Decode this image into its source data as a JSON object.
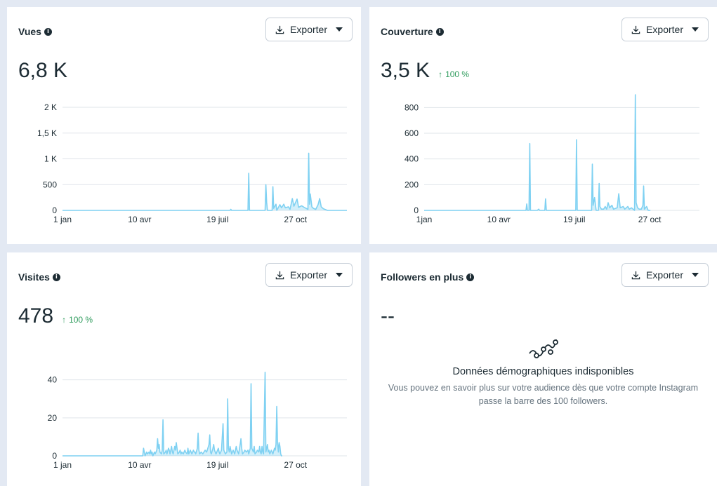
{
  "icons": {
    "info": "info-icon",
    "download": "download-icon",
    "caret": "caret-down-icon",
    "delta": "arrow-up-icon",
    "empty_chart": "chart-line-icon"
  },
  "colors": {
    "series": "#7fd1f2",
    "delta": "#2e9b5c",
    "background": "#e3e9f3"
  },
  "cards": {
    "vues": {
      "title": "Vues",
      "info_glyph": "i",
      "export_label": "Exporter",
      "value": "6,8 K",
      "chart_data": {
        "type": "area",
        "ylim": [
          0,
          2000
        ],
        "y_ticks": [
          {
            "v": 0,
            "label": "0"
          },
          {
            "v": 500,
            "label": "500"
          },
          {
            "v": 1000,
            "label": "1 K"
          },
          {
            "v": 1500,
            "label": "1,5 K"
          },
          {
            "v": 2000,
            "label": "2 K"
          }
        ],
        "x_ticks": [
          "1 jan",
          "10 avr",
          "19 juil",
          "27 oct"
        ],
        "x_tick_days": [
          0,
          99,
          199,
          299
        ],
        "x_range": [
          0,
          365
        ],
        "points": [
          [
            0,
            0
          ],
          [
            215,
            0
          ],
          [
            216,
            20
          ],
          [
            217,
            0
          ],
          [
            238,
            0
          ],
          [
            239,
            720
          ],
          [
            240,
            0
          ],
          [
            260,
            0
          ],
          [
            261,
            500
          ],
          [
            262,
            160
          ],
          [
            263,
            0
          ],
          [
            269,
            0
          ],
          [
            270,
            460
          ],
          [
            271,
            40
          ],
          [
            274,
            120
          ],
          [
            275,
            0
          ],
          [
            279,
            110
          ],
          [
            281,
            50
          ],
          [
            284,
            120
          ],
          [
            286,
            50
          ],
          [
            290,
            70
          ],
          [
            292,
            20
          ],
          [
            295,
            230
          ],
          [
            297,
            80
          ],
          [
            301,
            220
          ],
          [
            303,
            60
          ],
          [
            307,
            90
          ],
          [
            310,
            60
          ],
          [
            315,
            20
          ],
          [
            316,
            1110
          ],
          [
            317,
            120
          ],
          [
            318,
            320
          ],
          [
            320,
            70
          ],
          [
            322,
            40
          ],
          [
            325,
            20
          ],
          [
            328,
            110
          ],
          [
            330,
            230
          ],
          [
            332,
            70
          ],
          [
            335,
            30
          ],
          [
            340,
            0
          ],
          [
            365,
            0
          ]
        ]
      }
    },
    "couverture": {
      "title": "Couverture",
      "info_glyph": "i",
      "export_label": "Exporter",
      "value": "3,5 K",
      "delta": "100 %",
      "delta_glyph": "↑",
      "chart_data": {
        "type": "area",
        "ylim": [
          0,
          900
        ],
        "y_ticks": [
          {
            "v": 0,
            "label": "0"
          },
          {
            "v": 200,
            "label": "200"
          },
          {
            "v": 400,
            "label": "400"
          },
          {
            "v": 600,
            "label": "600"
          },
          {
            "v": 800,
            "label": "800"
          }
        ],
        "x_ticks": [
          "1jan",
          "10 avr",
          "19 juil",
          "27 oct"
        ],
        "x_tick_days": [
          0,
          99,
          199,
          299
        ],
        "x_range": [
          0,
          365
        ],
        "points": [
          [
            0,
            0
          ],
          [
            135,
            0
          ],
          [
            136,
            50
          ],
          [
            137,
            0
          ],
          [
            139,
            0
          ],
          [
            140,
            520
          ],
          [
            141,
            0
          ],
          [
            150,
            0
          ],
          [
            152,
            10
          ],
          [
            153,
            0
          ],
          [
            160,
            0
          ],
          [
            161,
            90
          ],
          [
            162,
            0
          ],
          [
            180,
            0
          ],
          [
            190,
            0
          ],
          [
            201,
            0
          ],
          [
            202,
            550
          ],
          [
            203,
            0
          ],
          [
            222,
            0
          ],
          [
            223,
            360
          ],
          [
            224,
            40
          ],
          [
            226,
            100
          ],
          [
            228,
            0
          ],
          [
            231,
            0
          ],
          [
            232,
            210
          ],
          [
            233,
            30
          ],
          [
            235,
            10
          ],
          [
            238,
            10
          ],
          [
            240,
            30
          ],
          [
            242,
            10
          ],
          [
            244,
            60
          ],
          [
            246,
            20
          ],
          [
            249,
            40
          ],
          [
            251,
            10
          ],
          [
            256,
            20
          ],
          [
            258,
            130
          ],
          [
            260,
            20
          ],
          [
            264,
            30
          ],
          [
            266,
            10
          ],
          [
            270,
            30
          ],
          [
            272,
            10
          ],
          [
            275,
            20
          ],
          [
            277,
            10
          ],
          [
            279,
            0
          ],
          [
            280,
            900
          ],
          [
            281,
            60
          ],
          [
            283,
            20
          ],
          [
            285,
            10
          ],
          [
            288,
            10
          ],
          [
            290,
            40
          ],
          [
            291,
            190
          ],
          [
            292,
            10
          ],
          [
            295,
            30
          ],
          [
            297,
            0
          ],
          [
            300,
            0
          ]
        ]
      }
    },
    "visites": {
      "title": "Visites",
      "info_glyph": "i",
      "export_label": "Exporter",
      "value": "478",
      "delta": "100 %",
      "delta_glyph": "↑",
      "chart_data": {
        "type": "area",
        "ylim": [
          0,
          48
        ],
        "y_ticks": [
          {
            "v": 0,
            "label": "0"
          },
          {
            "v": 20,
            "label": "20"
          },
          {
            "v": 40,
            "label": "40"
          }
        ],
        "x_ticks": [
          "1 jan",
          "10 avr",
          "19 juil",
          "27 oct"
        ],
        "x_tick_days": [
          0,
          99,
          199,
          299
        ],
        "x_range": [
          0,
          365
        ],
        "points": [
          [
            0,
            0
          ],
          [
            103,
            0
          ],
          [
            104,
            4
          ],
          [
            105,
            2
          ],
          [
            106,
            0
          ],
          [
            108,
            2
          ],
          [
            109,
            1
          ],
          [
            111,
            2
          ],
          [
            112,
            1
          ],
          [
            113,
            3
          ],
          [
            114,
            1
          ],
          [
            115,
            2
          ],
          [
            116,
            0
          ],
          [
            118,
            2
          ],
          [
            119,
            1
          ],
          [
            121,
            3
          ],
          [
            122,
            9
          ],
          [
            123,
            4
          ],
          [
            124,
            6
          ],
          [
            125,
            2
          ],
          [
            127,
            1
          ],
          [
            128,
            3
          ],
          [
            129,
            19
          ],
          [
            130,
            1
          ],
          [
            132,
            2
          ],
          [
            133,
            3
          ],
          [
            134,
            1
          ],
          [
            136,
            4
          ],
          [
            137,
            3
          ],
          [
            138,
            1
          ],
          [
            140,
            5
          ],
          [
            141,
            2
          ],
          [
            142,
            1
          ],
          [
            144,
            5
          ],
          [
            145,
            3
          ],
          [
            146,
            7
          ],
          [
            147,
            4
          ],
          [
            148,
            1
          ],
          [
            150,
            2
          ],
          [
            151,
            3
          ],
          [
            152,
            1
          ],
          [
            153,
            2
          ],
          [
            155,
            1
          ],
          [
            157,
            3
          ],
          [
            158,
            2
          ],
          [
            160,
            1
          ],
          [
            161,
            4
          ],
          [
            162,
            1
          ],
          [
            164,
            3
          ],
          [
            165,
            2
          ],
          [
            166,
            1
          ],
          [
            168,
            3
          ],
          [
            169,
            2
          ],
          [
            170,
            2
          ],
          [
            171,
            1
          ],
          [
            173,
            4
          ],
          [
            174,
            12
          ],
          [
            175,
            3
          ],
          [
            176,
            1
          ],
          [
            178,
            2
          ],
          [
            180,
            1
          ],
          [
            183,
            3
          ],
          [
            185,
            2
          ],
          [
            188,
            6
          ],
          [
            189,
            11
          ],
          [
            190,
            2
          ],
          [
            191,
            1
          ],
          [
            193,
            4
          ],
          [
            194,
            6
          ],
          [
            195,
            3
          ],
          [
            196,
            2
          ],
          [
            197,
            1
          ],
          [
            199,
            3
          ],
          [
            200,
            4
          ],
          [
            201,
            2
          ],
          [
            202,
            1
          ],
          [
            204,
            3
          ],
          [
            206,
            17
          ],
          [
            207,
            3
          ],
          [
            208,
            2
          ],
          [
            209,
            1
          ],
          [
            211,
            2
          ],
          [
            212,
            30
          ],
          [
            213,
            4
          ],
          [
            214,
            2
          ],
          [
            215,
            5
          ],
          [
            216,
            3
          ],
          [
            217,
            1
          ],
          [
            219,
            3
          ],
          [
            220,
            2
          ],
          [
            221,
            1
          ],
          [
            223,
            5
          ],
          [
            224,
            3
          ],
          [
            225,
            2
          ],
          [
            226,
            1
          ],
          [
            228,
            6
          ],
          [
            229,
            9
          ],
          [
            230,
            4
          ],
          [
            231,
            1
          ],
          [
            233,
            2
          ],
          [
            234,
            3
          ],
          [
            236,
            2
          ],
          [
            238,
            3
          ],
          [
            239,
            1
          ],
          [
            241,
            4
          ],
          [
            242,
            38
          ],
          [
            243,
            4
          ],
          [
            245,
            2
          ],
          [
            246,
            5
          ],
          [
            247,
            1
          ],
          [
            249,
            2
          ],
          [
            250,
            3
          ],
          [
            252,
            2
          ],
          [
            253,
            5
          ],
          [
            254,
            2
          ],
          [
            255,
            1
          ],
          [
            256,
            5
          ],
          [
            257,
            2
          ],
          [
            258,
            1
          ],
          [
            260,
            44
          ],
          [
            261,
            2
          ],
          [
            262,
            4
          ],
          [
            263,
            6
          ],
          [
            264,
            2
          ],
          [
            265,
            3
          ],
          [
            266,
            1
          ],
          [
            268,
            3
          ],
          [
            269,
            2
          ],
          [
            270,
            1
          ],
          [
            272,
            4
          ],
          [
            273,
            3
          ],
          [
            274,
            6
          ],
          [
            275,
            26
          ],
          [
            276,
            7
          ],
          [
            277,
            2
          ],
          [
            278,
            7
          ],
          [
            279,
            5
          ],
          [
            280,
            1
          ],
          [
            281,
            0
          ],
          [
            282,
            0
          ]
        ]
      }
    },
    "followers": {
      "title": "Followers en plus",
      "info_glyph": "i",
      "export_label": "Exporter",
      "value": "--",
      "empty_title": "Données démographiques indisponibles",
      "empty_text": "Vous pouvez en savoir plus sur votre audience dès que votre compte Instagram passe la barre des 100 followers."
    }
  }
}
